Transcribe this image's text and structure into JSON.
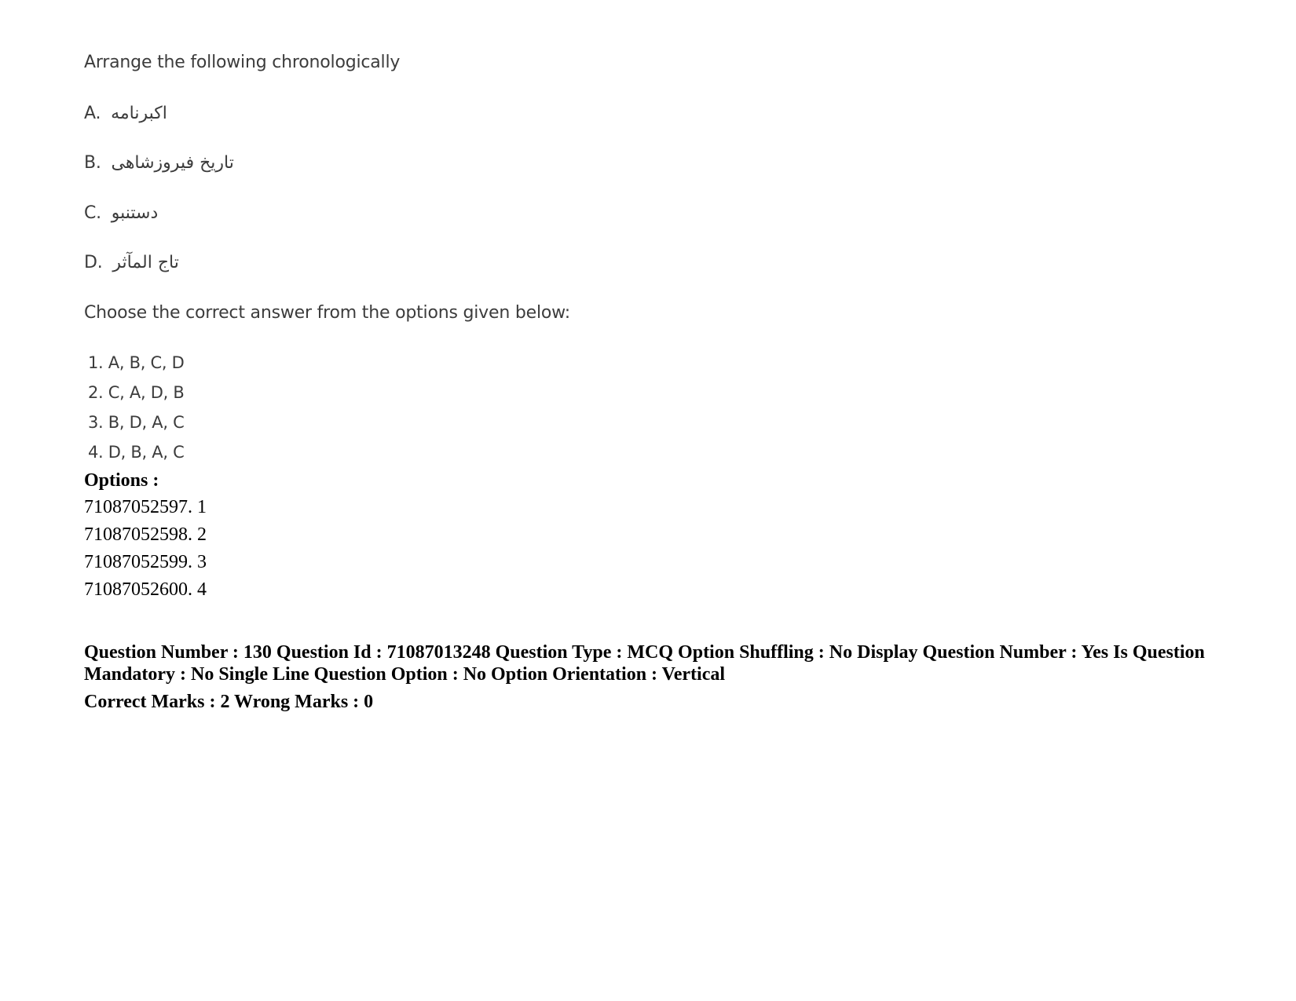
{
  "question": {
    "prompt": "Arrange the following chronologically",
    "statements": [
      {
        "label": "A.",
        "text": "اکبرنامه"
      },
      {
        "label": "B.",
        "text": "تاریخ فیروزشاهی"
      },
      {
        "label": "C.",
        "text": "دستنبو"
      },
      {
        "label": "D.",
        "text": "تاج المآثر"
      }
    ],
    "instruction": "Choose the correct answer from the options given below:",
    "choices": [
      "1. A, B, C, D",
      "2. C, A, D, B",
      "3. B, D, A, C",
      "4. D, B, A, C"
    ]
  },
  "options": {
    "heading": "Options :",
    "items": [
      "71087052597. 1",
      "71087052598. 2",
      "71087052599. 3",
      "71087052600. 4"
    ]
  },
  "next_question_meta": {
    "line1": "Question Number : 130 Question Id : 71087013248 Question Type : MCQ Option Shuffling : No Display Question Number : Yes Is Question Mandatory : No Single Line Question Option : No Option Orientation : Vertical",
    "marks": "Correct Marks : 2 Wrong Marks : 0"
  }
}
